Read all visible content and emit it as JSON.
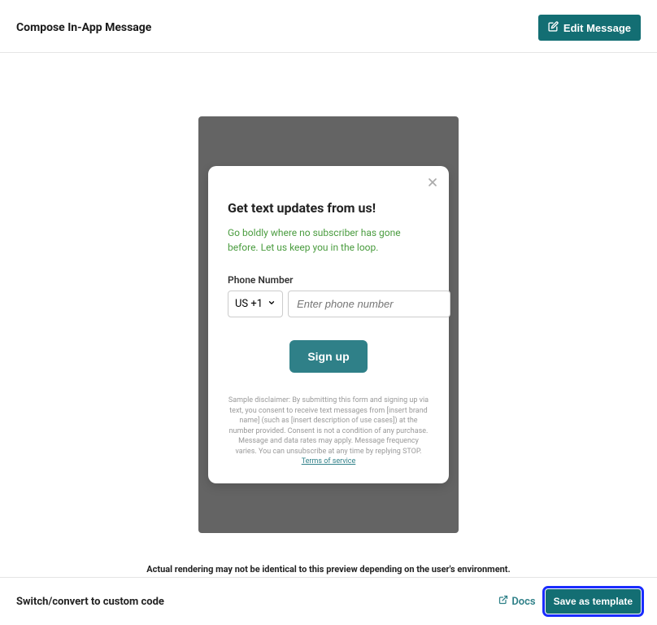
{
  "header": {
    "title": "Compose In-App Message",
    "edit_button_label": "Edit Message"
  },
  "preview": {
    "modal": {
      "title": "Get text updates from us!",
      "subtitle": "Go boldly where no subscriber has gone before. Let us keep you in the loop.",
      "phone_label": "Phone Number",
      "country_code": "US +1",
      "phone_placeholder": "Enter phone number",
      "signup_label": "Sign up",
      "disclaimer": "Sample disclaimer: By submitting this form and signing up via text, you consent to receive text messages from [insert brand name] (such as [insert description of use cases]) at the number provided. Consent is not a condition of any purchase. Message and data rates may apply. Message frequency varies. You can unsubscribe at any time by replying STOP.",
      "terms_label": "Terms of service"
    },
    "render_note": "Actual rendering may not be identical to this preview depending on the user's environment."
  },
  "footer": {
    "switch_label": "Switch/convert to custom code",
    "docs_label": "Docs",
    "save_template_label": "Save as template"
  }
}
